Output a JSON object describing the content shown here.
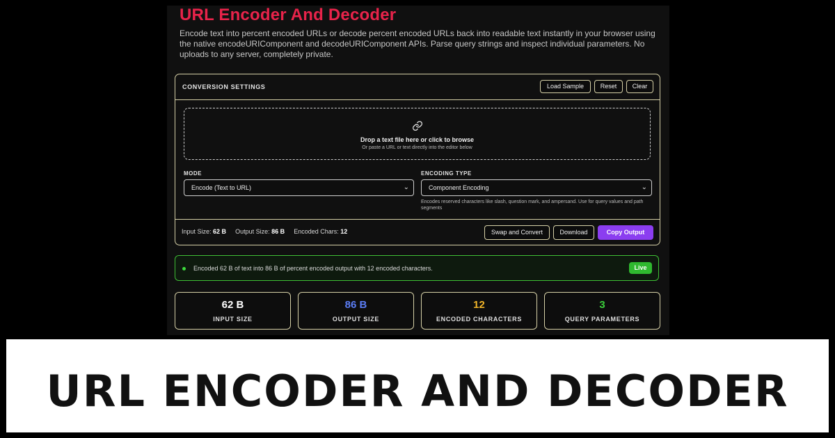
{
  "app": {
    "title": "URL Encoder And Decoder",
    "description": "Encode text into percent encoded URLs or decode percent encoded URLs back into readable text instantly in your browser using the native encodeURIComponent and decodeURIComponent APIs. Parse query strings and inspect individual parameters. No uploads to any server, completely private."
  },
  "settings": {
    "heading": "CONVERSION SETTINGS",
    "load_sample": "Load Sample",
    "reset": "Reset",
    "clear": "Clear"
  },
  "dropzone": {
    "icon": "link-icon",
    "main": "Drop a text file here or click to browse",
    "sub": "Or paste a URL or text directly into the editor below"
  },
  "mode": {
    "label": "MODE",
    "value": "Encode (Text to URL)"
  },
  "encoding": {
    "label": "ENCODING TYPE",
    "value": "Component Encoding",
    "hint": "Encodes reserved characters like slash, question mark, and ampersand. Use for query values and path segments"
  },
  "footer": {
    "input_size_label": "Input Size:",
    "input_size": "62 B",
    "output_size_label": "Output Size:",
    "output_size": "86 B",
    "encoded_chars_label": "Encoded Chars:",
    "encoded_chars": "12",
    "swap": "Swap and Convert",
    "download": "Download",
    "copy": "Copy Output"
  },
  "status": {
    "text": "Encoded 62 B of text into 86 B of percent encoded output with 12 encoded characters.",
    "badge": "Live"
  },
  "cards": [
    {
      "value": "62 B",
      "label": "INPUT SIZE",
      "color": "#ffffff"
    },
    {
      "value": "86 B",
      "label": "OUTPUT SIZE",
      "color": "#5b7df5"
    },
    {
      "value": "12",
      "label": "ENCODED CHARACTERS",
      "color": "#f0b429"
    },
    {
      "value": "3",
      "label": "QUERY PARAMETERS",
      "color": "#3ccf3c"
    }
  ],
  "banner": {
    "text": "URL ENCODER AND DECODER"
  },
  "colors": {
    "title": "#e8234a",
    "accent": "#8b3df0",
    "success": "#2fb82f",
    "border": "#d8d2a8"
  }
}
